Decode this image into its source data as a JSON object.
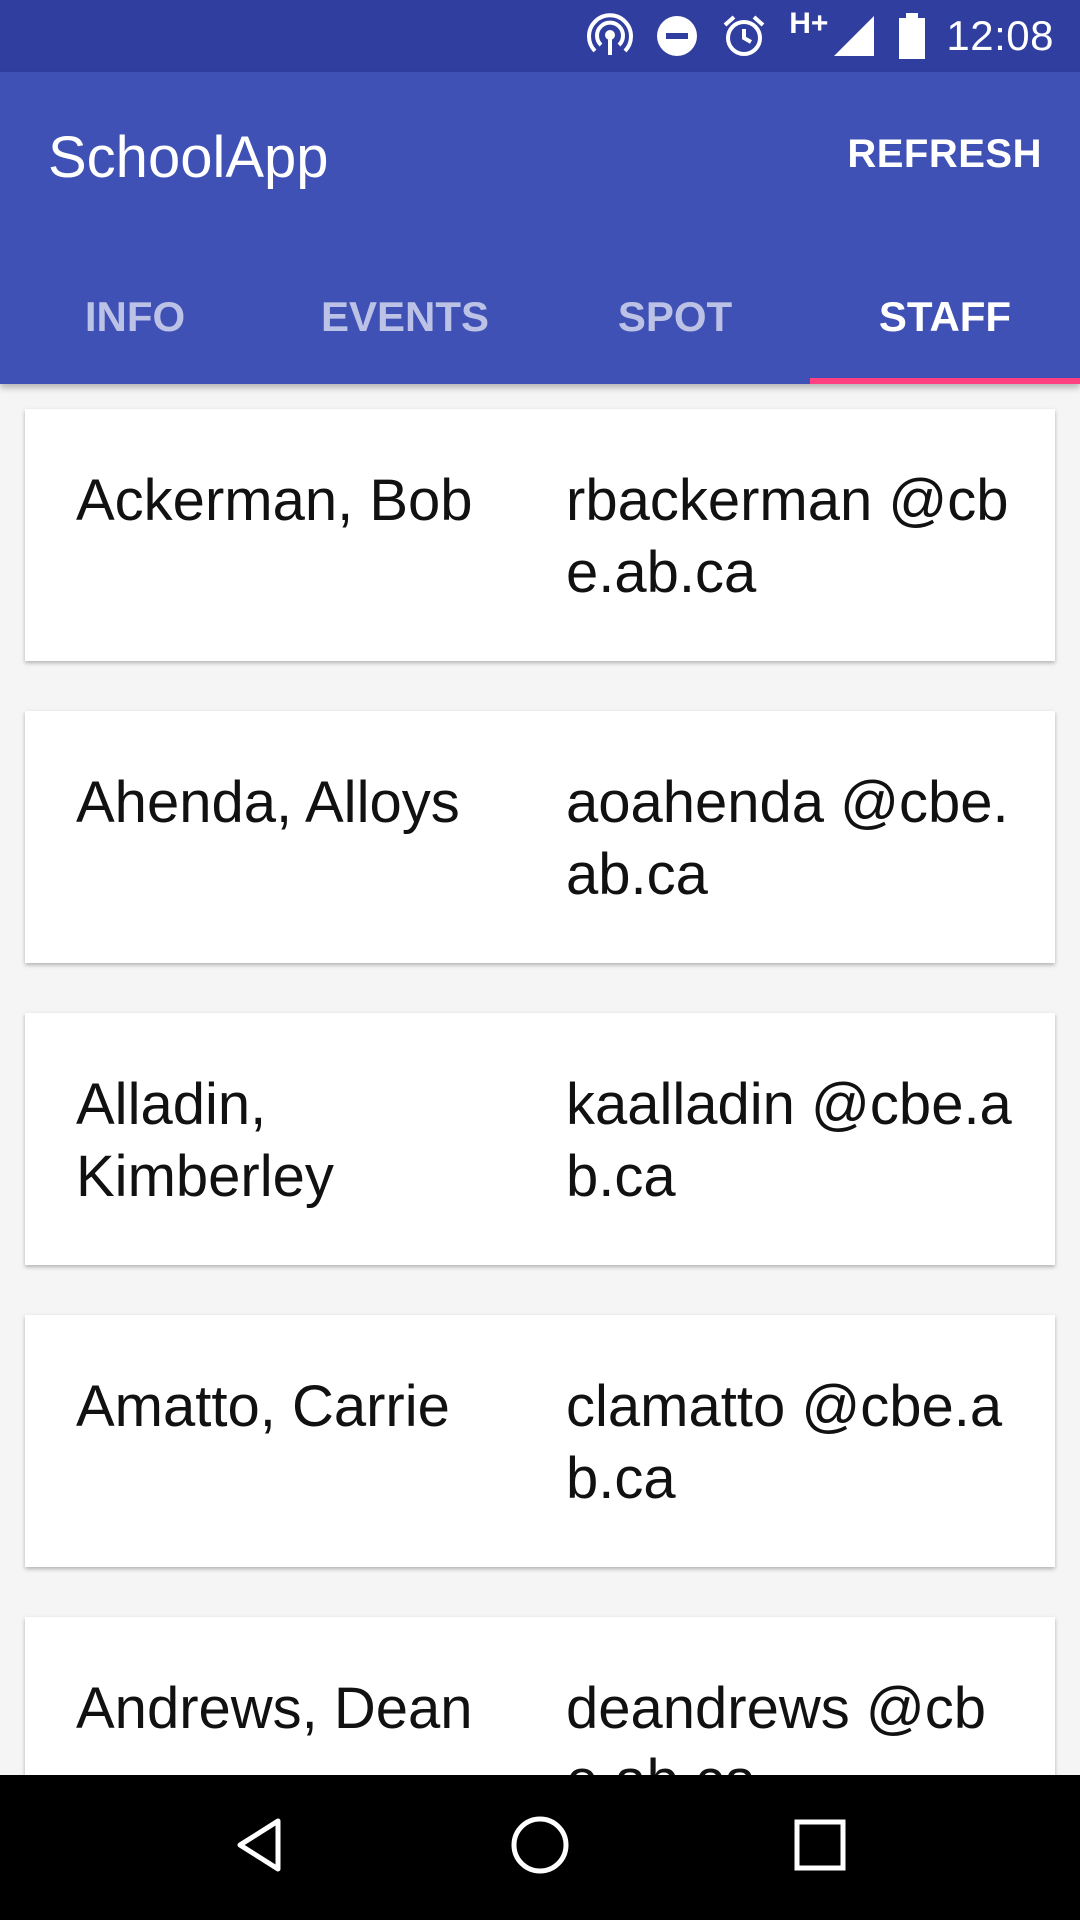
{
  "status_bar": {
    "network_label": "H+",
    "time": "12:08",
    "icons": [
      "hotspot-icon",
      "do-not-disturb-icon",
      "alarm-icon",
      "signal-icon",
      "battery-icon"
    ]
  },
  "app_bar": {
    "title": "SchoolApp",
    "refresh_label": "REFRESH",
    "accent_color": "#3f51b5",
    "indicator_color": "#ff4081"
  },
  "tabs": [
    {
      "label": "INFO",
      "active": false
    },
    {
      "label": "EVENTS",
      "active": false
    },
    {
      "label": "SPOT",
      "active": false
    },
    {
      "label": "STAFF",
      "active": true
    }
  ],
  "staff": [
    {
      "name": "Ackerman, Bob",
      "email": "rbackerman @cbe.ab.ca"
    },
    {
      "name": "Ahenda, Alloys",
      "email": "aoahenda @cbe.ab.ca"
    },
    {
      "name": "Alladin, Kimberley",
      "email": "kaalladin @cbe.ab.ca"
    },
    {
      "name": "Amatto, Carrie",
      "email": "clamatto @cbe.ab.ca"
    },
    {
      "name": "Andrews, Dean",
      "email": "deandrews @cbe.ab.ca"
    }
  ],
  "nav_bar": {
    "icons": [
      "back-icon",
      "home-icon",
      "recents-icon"
    ]
  }
}
